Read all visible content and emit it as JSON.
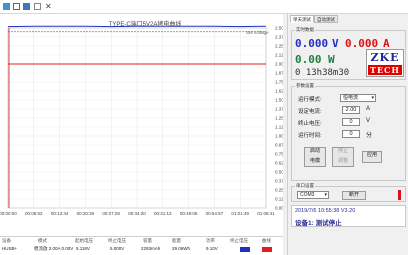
{
  "toolbar": {
    "close_glyph": "✕"
  },
  "chart": {
    "title": "TYPE-C端口5V2A拷电曲线",
    "series_name": "Set voltage"
  },
  "chart_data": {
    "type": "line",
    "title": "TYPE-C端口5V2A拷电曲线",
    "x": [
      "00:00:00",
      "00:06:52",
      "00:13:44",
      "00:20:36",
      "00:27:28",
      "00:34:20",
      "00:41:13",
      "00:48:05",
      "00:54:57",
      "01:01:49",
      "01:08:41"
    ],
    "y_left_ticks": [
      0,
      0.5,
      1,
      1.5,
      2,
      2.5,
      3,
      3.5,
      4,
      4.5,
      5
    ],
    "y_right_ticks": [
      "0.000",
      "0.125",
      "0.250",
      "0.375",
      "0.500",
      "0.625",
      "0.750",
      "0.875",
      "1.000",
      "1.125",
      "1.250",
      "1.375",
      "1.500",
      "1.625",
      "1.750",
      "1.875",
      "2.000",
      "2.125",
      "2.250",
      "2.375",
      "2.500"
    ],
    "ylim_left": [
      0,
      5
    ],
    "ylim_right": [
      0,
      2.5
    ],
    "grid": true,
    "series": [
      {
        "name": "Voltage",
        "axis": "left",
        "color": "#2030c0",
        "values": [
          5.04,
          5.05,
          5.05,
          5.05,
          5.04,
          5.05,
          5.05,
          5.05,
          5.05,
          5.04,
          5.05
        ]
      },
      {
        "name": "Current",
        "axis": "right",
        "color": "#e02020",
        "values": [
          2.0,
          2.0,
          2.0,
          2.0,
          2.0,
          2.0,
          2.0,
          2.0,
          2.0,
          2.0,
          2.0
        ]
      },
      {
        "name": "Set voltage",
        "axis": "left",
        "color": "#a0a0a0",
        "values": [
          4.9,
          4.9,
          4.9,
          4.9,
          4.9,
          4.9,
          4.9,
          4.9,
          4.9,
          4.9,
          4.9
        ]
      }
    ]
  },
  "status_table": {
    "headers": [
      "设备",
      "模式",
      "起始电压",
      "终止电压",
      "容量",
      "能量",
      "功率",
      "终止电压",
      "曲线"
    ],
    "values": [
      "HUSB+",
      "稳流放 2.00A 0.00V",
      "5.118V",
      "5.000V",
      "2293mAh",
      "29.06Wh",
      "9.10V",
      "",
      ""
    ],
    "swatch_colors": [
      "#2030c0",
      "#e02020"
    ]
  },
  "panel": {
    "tabs": [
      "单天测试",
      "自动测试"
    ],
    "readings_title": "实时数据",
    "voltage": "0.000",
    "voltage_unit": "V",
    "current": "0.000",
    "current_unit": "A",
    "power": "0.00",
    "power_unit": "W",
    "time": "0 13h38m30",
    "logo_top": "ZKE",
    "logo_bottom": "TECH",
    "params_title": "参数设置",
    "mode_label": "运行模式:",
    "mode_value": "恒电流",
    "set_current_label": "设定电流:",
    "set_current_value": "2.00",
    "set_current_unit": "A",
    "stop_voltage_label": "终止电压:",
    "stop_voltage_value": "0",
    "stop_voltage_unit": "V",
    "run_time_label": "运行时间:",
    "run_time_value": "0",
    "run_time_unit": "分",
    "start_btn_1": "启动",
    "start_btn_2": "电模",
    "stop_btn_1": "停止",
    "stop_btn_2": "调整",
    "apply_btn": "应用",
    "port_title": "串口设置",
    "port_value": "COM3",
    "open_btn": "断开",
    "info_line1": "2019/7/6 10:55:38  V3.20",
    "info_line2": "设备1: 测试停止"
  }
}
